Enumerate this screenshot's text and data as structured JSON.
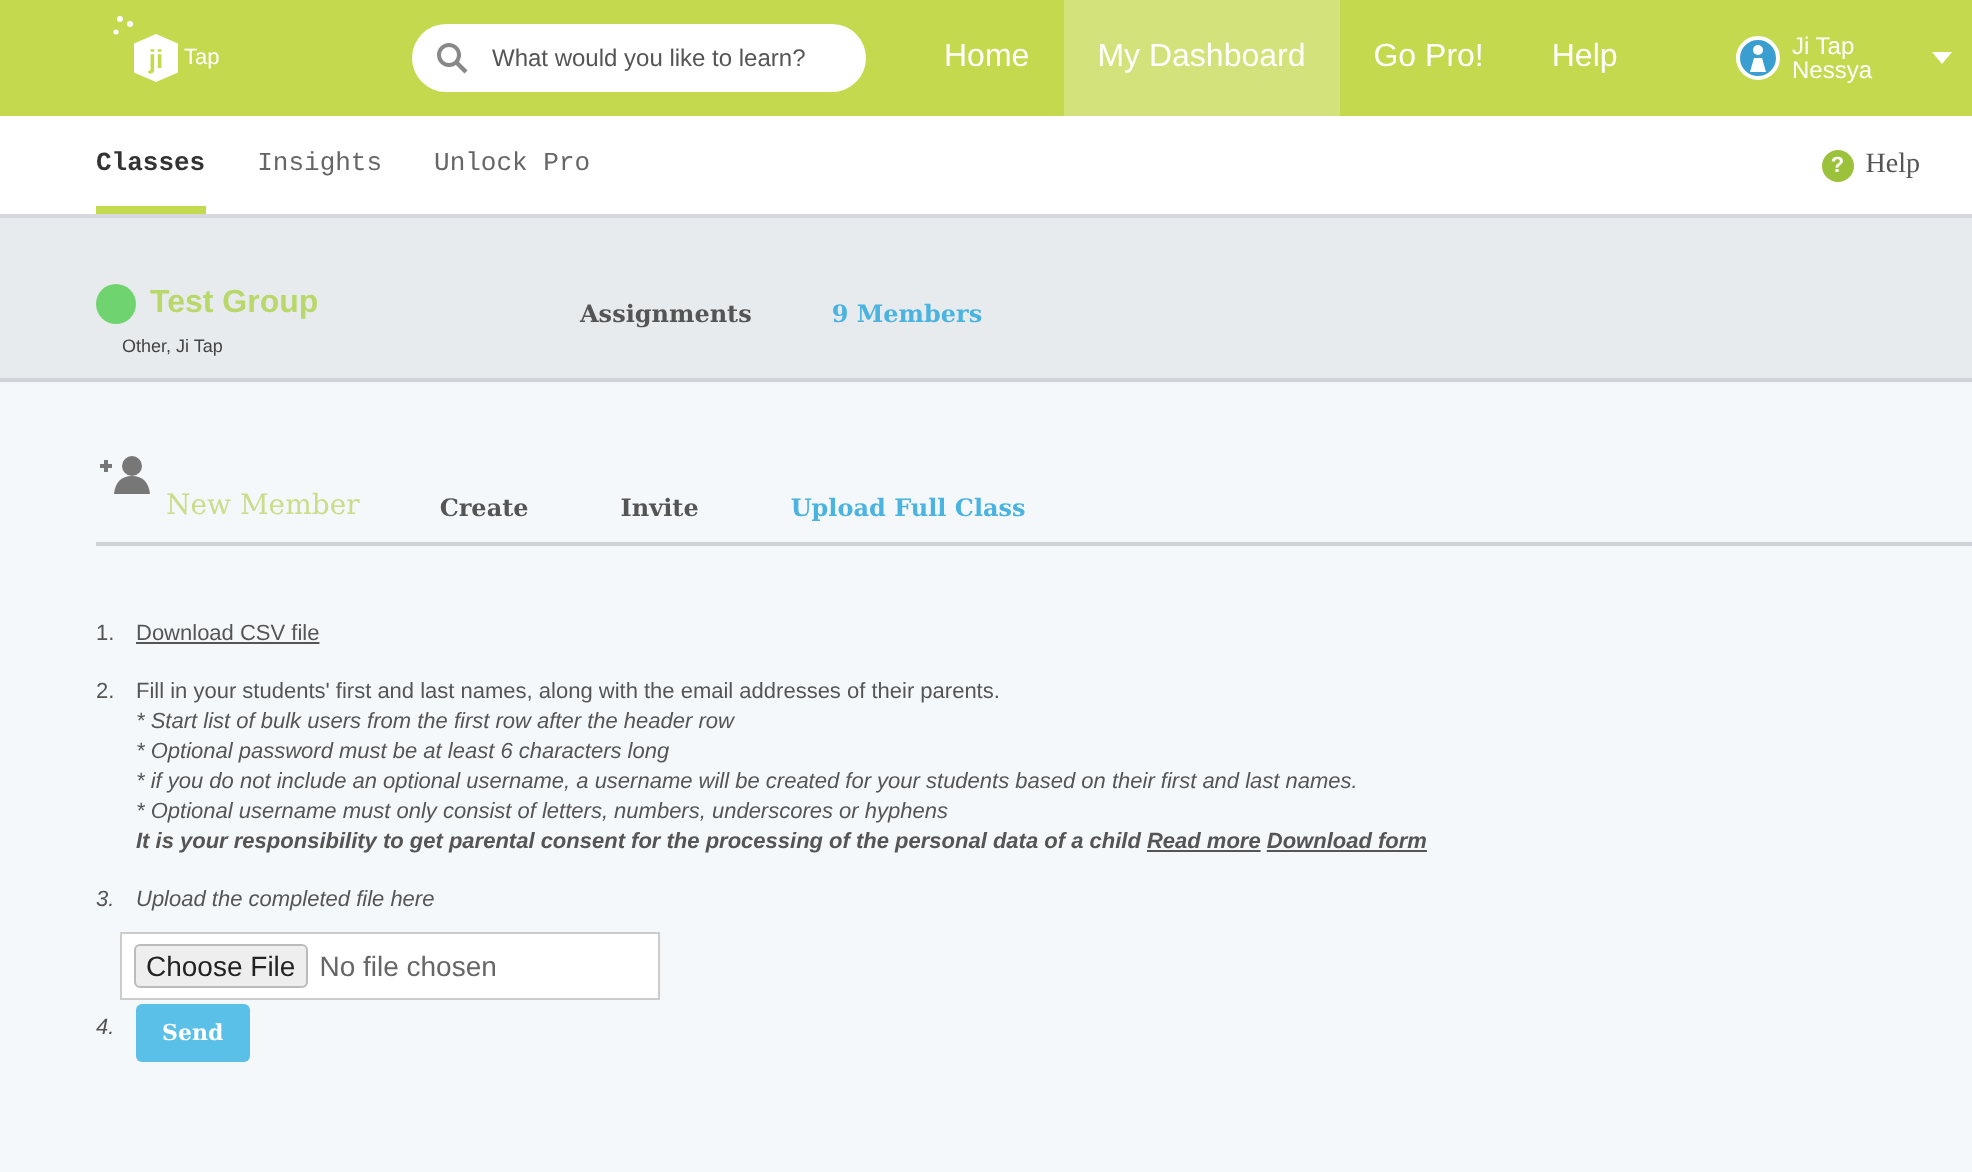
{
  "header": {
    "logo_mark": "ji",
    "logo_text": "Tap",
    "search": {
      "placeholder": "What would you like to learn?"
    },
    "nav": [
      {
        "label": "Home",
        "selected": false
      },
      {
        "label": "My Dashboard",
        "selected": true
      },
      {
        "label": "Go Pro!",
        "selected": false
      },
      {
        "label": "Help",
        "selected": false
      }
    ],
    "user": {
      "first_line": "Ji Tap",
      "second_line": "Nessya"
    }
  },
  "subnav": {
    "tabs": [
      {
        "label": "Classes",
        "selected": true
      },
      {
        "label": "Insights",
        "selected": false
      },
      {
        "label": "Unlock Pro",
        "selected": false
      }
    ],
    "help_icon": "?",
    "help": "Help"
  },
  "group": {
    "name": "Test Group",
    "subtitle": "Other, Ji Tap",
    "tabs": [
      {
        "label": "Assignments",
        "selected": false
      },
      {
        "label": "9 Members",
        "selected": true
      }
    ]
  },
  "new_member": {
    "title": "New Member",
    "tabs": [
      {
        "label": "Create",
        "selected": false
      },
      {
        "label": "Invite",
        "selected": false
      },
      {
        "label": "Upload Full Class",
        "selected": true
      }
    ]
  },
  "steps": [
    {
      "number": "1.",
      "kind": "link",
      "text": "Download CSV file"
    },
    {
      "number": "2.",
      "kind": "instructions",
      "text": "Fill in your students' first and last names, along with the email addresses of their parents.",
      "notes": [
        "* Start list of bulk users from the first row after the header row",
        "* Optional password must be at least 6 characters long",
        "* if you do not include an optional username, a username will be created for your students based on their first and last names.",
        "* Optional username must only consist of letters, numbers, underscores or hyphens"
      ],
      "consent": "It is your responsibility to get parental consent for the processing of the personal data of a child",
      "links": [
        "Read more",
        "Download form"
      ]
    },
    {
      "number": "3.",
      "kind": "upload",
      "text": "Upload the completed file here",
      "button": "Choose File",
      "status": "No file chosen"
    },
    {
      "number": "4.",
      "kind": "submit",
      "button": "Send"
    }
  ]
}
